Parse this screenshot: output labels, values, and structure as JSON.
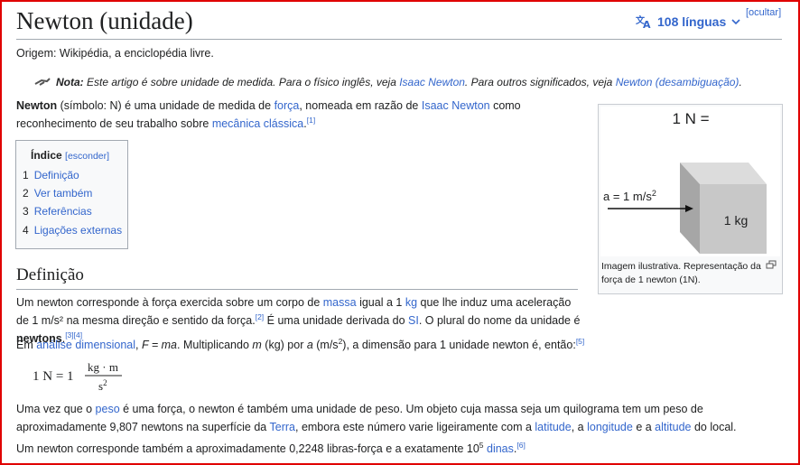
{
  "title": "Newton (unidade)",
  "languages": {
    "label": "108 línguas"
  },
  "hide_label": "[ocultar]",
  "origin": "Origem: Wikipédia, a enciclopédia livre.",
  "hatnote": {
    "bold": "Nota:",
    "t1": " Este artigo é sobre unidade de medida. Para o físico inglês, veja ",
    "link1": "Isaac Newton",
    "t2": ". Para outros significados, veja ",
    "link2": "Newton (desambiguação)",
    "t3": "."
  },
  "intro": {
    "bold": "Newton",
    "t1": " (símbolo: N) é uma unidade de medida de ",
    "link1": "força",
    "t2": ", nomeada em razão de ",
    "link2": "Isaac Newton",
    "t3": " como",
    "t4": "reconhecimento de seu trabalho sobre ",
    "link3": "mecânica clássica",
    "t5": ".",
    "ref": "[1]"
  },
  "toc": {
    "title": "Índice",
    "hide": "[esconder]",
    "items": [
      {
        "num": "1",
        "label": "Definição"
      },
      {
        "num": "2",
        "label": "Ver também"
      },
      {
        "num": "3",
        "label": "Referências"
      },
      {
        "num": "4",
        "label": "Ligações externas"
      }
    ]
  },
  "infobox": {
    "figure_title": "1 N =",
    "accel": "a = 1 m/s",
    "accel_exp": "2",
    "mass": "1 kg",
    "caption": "Imagem ilustrativa. Representação da força de 1 newton (1N).",
    "colors": {
      "box_front": "#c8c8c8",
      "box_side": "#a6a6a6",
      "box_top": "#dcdcdc"
    }
  },
  "section_definicao": "Definição",
  "p1": {
    "t1": "Um newton corresponde à força exercida sobre um corpo de ",
    "link1": "massa",
    "t2": " igual a 1 ",
    "link2": "kg",
    "t3": " que lhe induz uma aceleração",
    "t4": "de 1 m/s² na mesma direção e sentido da força.",
    "ref1": "[2]",
    "t5": " É uma unidade derivada do ",
    "link3": "SI",
    "t6": ". O plural do nome da unidade é ",
    "bold": "newtons",
    "t7": ".",
    "ref2": "[3][4]"
  },
  "p2": {
    "t1": "Em ",
    "link1": "análise dimensional",
    "t2": ", ",
    "i1": "F = ma",
    "t3": ". Multiplicando ",
    "i2": "m",
    "t4": " (kg) por ",
    "i3": "a",
    "t5": " (m/s",
    "sup": "2",
    "t6": "), a dimensão para 1 unidade newton é, então:",
    "ref": "[5]"
  },
  "formula": {
    "lhs": "1 N = 1",
    "num": "kg · m",
    "den": "s",
    "den_exp": "2"
  },
  "p3": {
    "t1": "Uma vez que o ",
    "link1": "peso",
    "t2": " é uma força, o newton é também uma unidade de peso. Um objeto cuja massa seja um quilograma tem um peso de",
    "t3": "aproximadamente 9,807 newtons na superfície da ",
    "link2": "Terra",
    "t4": ", embora este número varie ligeiramente com a ",
    "link3": "latitude",
    "t5": ", a ",
    "link4": "longitude",
    "t6": " e a ",
    "link5": "altitude",
    "t7": " do local."
  },
  "p4": {
    "t1": "Um newton corresponde também a aproximadamente 0,2248 libras-força e a exatamente 10",
    "sup": "5",
    "t2": " ",
    "link1": "dinas",
    "t3": ".",
    "ref": "[6]"
  }
}
